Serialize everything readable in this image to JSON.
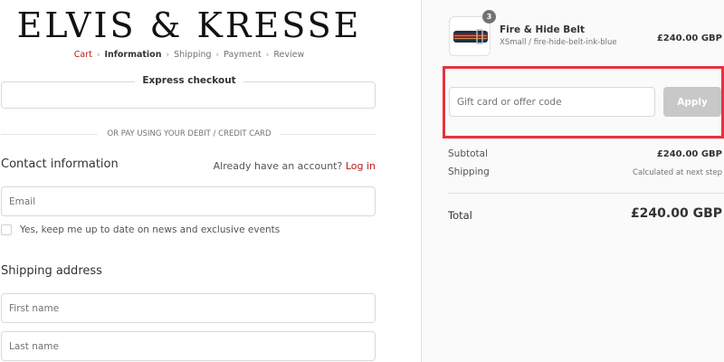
{
  "brand": {
    "logo_text": "ELVIS & KRESSE"
  },
  "breadcrumb": {
    "items": [
      {
        "label": "Cart",
        "state": "link"
      },
      {
        "label": "Information",
        "state": "current"
      },
      {
        "label": "Shipping",
        "state": "upcoming"
      },
      {
        "label": "Payment",
        "state": "upcoming"
      },
      {
        "label": "Review",
        "state": "upcoming"
      }
    ],
    "separator_icon": "chevron-right-icon"
  },
  "express_checkout": {
    "label": "Express checkout"
  },
  "divider": {
    "text": "OR PAY USING YOUR DEBIT / CREDIT CARD"
  },
  "contact": {
    "title": "Contact information",
    "account_prompt": "Already have an account?",
    "login_label": "Log in",
    "email_placeholder": "Email",
    "newsletter_label": "Yes, keep me up to date on news and exclusive events"
  },
  "shipping": {
    "title": "Shipping address",
    "first_name_placeholder": "First name",
    "last_name_placeholder": "Last name"
  },
  "order": {
    "product": {
      "name": "Fire & Hide Belt",
      "variant": "XSmall / fire-hide-belt-ink-blue",
      "price": "£240.00 GBP",
      "quantity": "3"
    },
    "gift_card_placeholder": "Gift card or offer code",
    "apply_label": "Apply",
    "subtotal_label": "Subtotal",
    "subtotal_value": "£240.00 GBP",
    "shipping_label": "Shipping",
    "shipping_value": "Calculated at next step",
    "total_label": "Total",
    "total_value": "£240.00 GBP"
  },
  "colors": {
    "accent": "#b81d1d",
    "highlight": "#e8323c",
    "apply_button": "#c8c8c8"
  }
}
